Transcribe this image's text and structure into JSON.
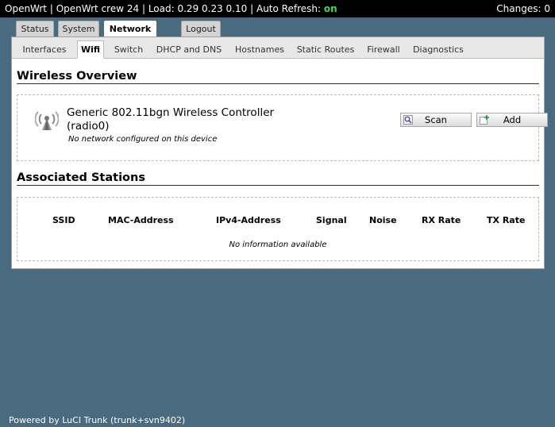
{
  "topbar": {
    "hostname": "OpenWrt",
    "release": "OpenWrt crew 24",
    "load_label": "Load:",
    "load": "0.29 0.23 0.10",
    "refresh_label": "Auto Refresh:",
    "refresh_state": "on",
    "changes_label": "Changes:",
    "changes": "0"
  },
  "main_tabs": [
    "Status",
    "System",
    "Network",
    "Logout"
  ],
  "sub_tabs": [
    "Interfaces",
    "Wifi",
    "Switch",
    "DHCP and DNS",
    "Hostnames",
    "Static Routes",
    "Firewall",
    "Diagnostics"
  ],
  "wireless": {
    "heading": "Wireless Overview",
    "device_title_line1": "Generic 802.11bgn Wireless Controller",
    "device_title_line2": "(radio0)",
    "device_note": "No network configured on this device",
    "scan_label": "Scan",
    "add_label": "Add"
  },
  "stations": {
    "heading": "Associated Stations",
    "columns": [
      "SSID",
      "MAC-Address",
      "IPv4-Address",
      "Signal",
      "Noise",
      "RX Rate",
      "TX Rate"
    ],
    "empty_text": "No information available"
  },
  "footer": "Powered by LuCI Trunk (trunk+svn9402)"
}
